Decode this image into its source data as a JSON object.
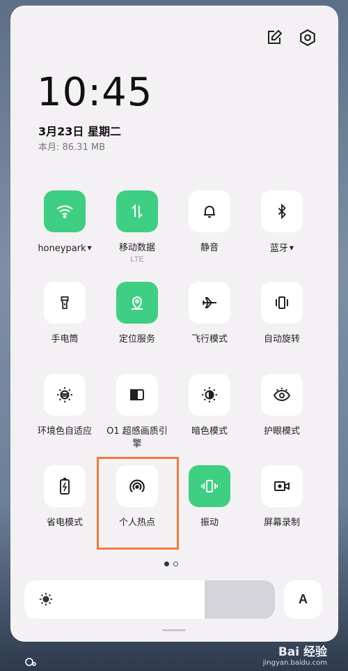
{
  "status": {
    "time": "10:45",
    "date": "3月23日  星期二",
    "data_usage": "本月: 86.31 MB"
  },
  "header_icons": [
    "edit-icon",
    "settings-icon"
  ],
  "tiles": [
    {
      "label": "honeypark",
      "dropdown": true,
      "active": true,
      "icon": "wifi-icon"
    },
    {
      "label": "移动数据",
      "sub": "LTE",
      "active": true,
      "icon": "mobile-data-icon"
    },
    {
      "label": "静音",
      "active": false,
      "icon": "bell-icon"
    },
    {
      "label": "蓝牙",
      "dropdown": true,
      "active": false,
      "icon": "bluetooth-icon"
    },
    {
      "label": "手电筒",
      "active": false,
      "icon": "flashlight-icon"
    },
    {
      "label": "定位服务",
      "active": true,
      "icon": "location-icon"
    },
    {
      "label": "飞行模式",
      "active": false,
      "icon": "airplane-icon"
    },
    {
      "label": "自动旋转",
      "active": false,
      "icon": "rotate-icon"
    },
    {
      "label": "环境色自适应",
      "active": false,
      "icon": "ambient-color-icon"
    },
    {
      "label": "O1 超感画质引擎",
      "active": false,
      "icon": "display-engine-icon"
    },
    {
      "label": "暗色模式",
      "active": false,
      "icon": "dark-mode-icon"
    },
    {
      "label": "护眼模式",
      "active": false,
      "icon": "eye-icon"
    },
    {
      "label": "省电模式",
      "active": false,
      "icon": "battery-icon"
    },
    {
      "label": "个人热点",
      "active": false,
      "icon": "hotspot-icon",
      "highlighted": true
    },
    {
      "label": "振动",
      "active": true,
      "icon": "vibrate-icon"
    },
    {
      "label": "屏幕录制",
      "active": false,
      "icon": "screen-record-icon"
    }
  ],
  "pager": {
    "current": 1,
    "total": 2
  },
  "brightness": {
    "level": 0.72,
    "icon": "sun-icon"
  },
  "font_button": {
    "label": "A"
  },
  "watermark": {
    "line1": "Bai 经验",
    "line2": "jingyan.baidu.com"
  },
  "colors": {
    "accent_on": "#3ecf82",
    "highlight": "#f07a3f"
  }
}
